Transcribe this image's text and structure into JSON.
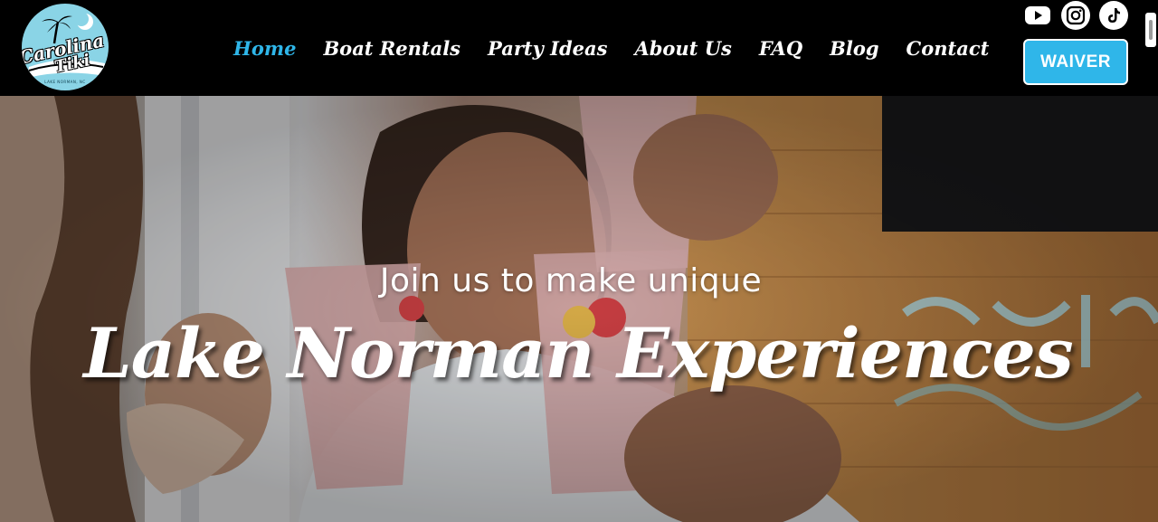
{
  "brand": {
    "logo_line1": "Carolina",
    "logo_line2": "Tiki",
    "logo_sub": "LAKE NORMAN, NC",
    "accent_color": "#2fb6e9"
  },
  "nav": {
    "items": [
      {
        "label": "Home",
        "active": true
      },
      {
        "label": "Boat Rentals",
        "active": false
      },
      {
        "label": "Party Ideas",
        "active": false
      },
      {
        "label": "About Us",
        "active": false
      },
      {
        "label": "FAQ",
        "active": false
      },
      {
        "label": "Blog",
        "active": false
      },
      {
        "label": "Contact",
        "active": false
      }
    ]
  },
  "socials": [
    {
      "name": "youtube-icon"
    },
    {
      "name": "instagram-icon"
    },
    {
      "name": "tiktok-icon"
    }
  ],
  "waiver_label": "WAIVER",
  "hero": {
    "subtitle": "Join us to make unique",
    "title": "Lake Norman Experiences"
  }
}
